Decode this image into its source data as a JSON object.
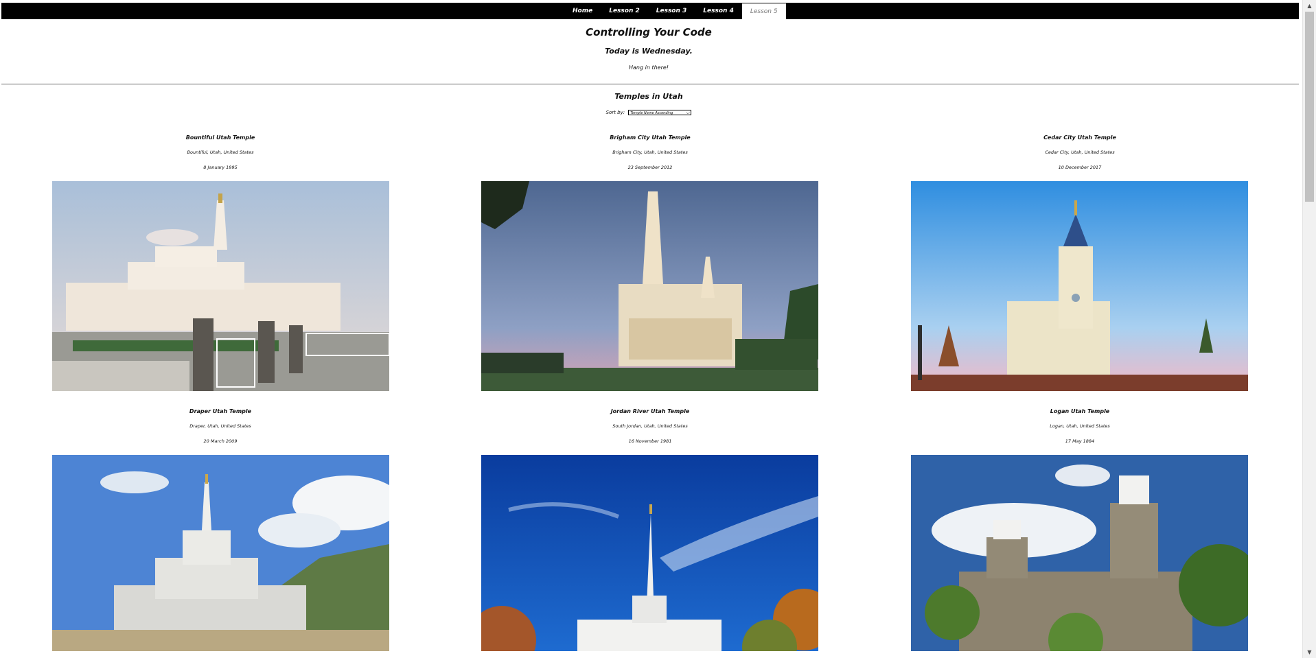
{
  "nav": {
    "items": [
      {
        "label": "Home"
      },
      {
        "label": "Lesson 2"
      },
      {
        "label": "Lesson 3"
      },
      {
        "label": "Lesson 4"
      },
      {
        "label": "Lesson 5"
      }
    ],
    "active_index": 4
  },
  "header": {
    "title": "Controlling Your Code",
    "day_message": "Today is Wednesday.",
    "encouragement": "Hang in there!"
  },
  "temples_section": {
    "title": "Temples in Utah",
    "sort_label": "Sort by:",
    "sort_selected": "Temple Name Ascending"
  },
  "temples": [
    {
      "name": "Bountiful Utah Temple",
      "location": "Bountiful, Utah, United States",
      "dedicated": "8 January 1995",
      "image": "temple-photo"
    },
    {
      "name": "Brigham City Utah Temple",
      "location": "Brigham City, Utah, United States",
      "dedicated": "23 September 2012",
      "image": "temple-photo"
    },
    {
      "name": "Cedar City Utah Temple",
      "location": "Cedar City, Utah, United States",
      "dedicated": "10 December 2017",
      "image": "temple-photo"
    },
    {
      "name": "Draper Utah Temple",
      "location": "Draper, Utah, United States",
      "dedicated": "20 March 2009",
      "image": "temple-photo"
    },
    {
      "name": "Jordan River Utah Temple",
      "location": "South Jordan, Utah, United States",
      "dedicated": "16 November 1981",
      "image": "temple-photo"
    },
    {
      "name": "Logan Utah Temple",
      "location": "Logan, Utah, United States",
      "dedicated": "17 May 1884",
      "image": "temple-photo"
    }
  ],
  "colors": {
    "nav_background": "#000000",
    "page_background": "#ffffff",
    "scrollbar_thumb": "#c1c1c1"
  },
  "icons": {
    "select_chevron": "chevron-down-icon",
    "scroll_up": "arrow-up-icon",
    "scroll_down": "arrow-down-icon"
  }
}
